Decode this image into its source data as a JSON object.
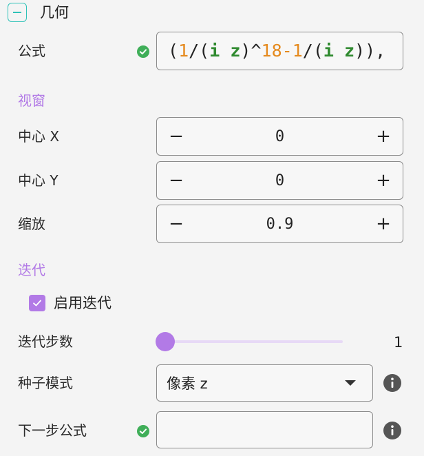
{
  "section": {
    "title": "几何"
  },
  "formula": {
    "label": "公式",
    "tokens": [
      {
        "t": "(",
        "k": "plain"
      },
      {
        "t": "1",
        "k": "num"
      },
      {
        "t": "/(",
        "k": "plain"
      },
      {
        "t": "i",
        "k": "var"
      },
      {
        "t": " ",
        "k": "plain"
      },
      {
        "t": "z",
        "k": "var"
      },
      {
        "t": ")^",
        "k": "plain"
      },
      {
        "t": "18",
        "k": "num"
      },
      {
        "t": "-",
        "k": "op"
      },
      {
        "t": "1",
        "k": "num"
      },
      {
        "t": "/(",
        "k": "plain"
      },
      {
        "t": "i",
        "k": "var"
      },
      {
        "t": " ",
        "k": "plain"
      },
      {
        "t": "z",
        "k": "var"
      },
      {
        "t": ")),",
        "k": "plain"
      }
    ]
  },
  "viewport": {
    "title": "视窗",
    "center_x": {
      "label": "中心 X",
      "value": "0",
      "minus": "−",
      "plus": "+"
    },
    "center_y": {
      "label": "中心 Y",
      "value": "0",
      "minus": "−",
      "plus": "+"
    },
    "zoom": {
      "label": "缩放",
      "value": "0.9",
      "minus": "−",
      "plus": "+"
    }
  },
  "iteration": {
    "title": "迭代",
    "enable_label": "启用迭代",
    "enabled": true,
    "steps_label": "迭代步数",
    "steps_value": "1",
    "seed_label": "种子模式",
    "seed_value": "像素 z",
    "next_label": "下一步公式",
    "next_value": ""
  },
  "colors": {
    "accent": "#b27ae6",
    "teal": "#2fc2b8",
    "ok": "#3fae58"
  }
}
